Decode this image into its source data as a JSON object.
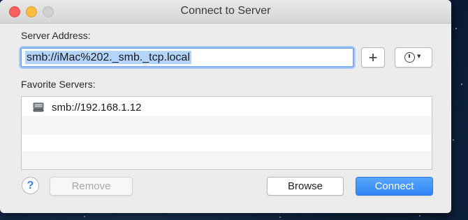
{
  "window": {
    "title": "Connect to Server"
  },
  "server_address": {
    "label": "Server Address:",
    "value": "smb://iMac%202._smb._tcp.local",
    "add_button": "+"
  },
  "favorites": {
    "label": "Favorite Servers:",
    "items": [
      {
        "address": "smb://192.168.1.12",
        "icon": "server-drive-icon"
      }
    ]
  },
  "buttons": {
    "help": "?",
    "remove": "Remove",
    "browse": "Browse",
    "connect": "Connect"
  },
  "colors": {
    "accent": "#2f86f6",
    "close": "#fc605c",
    "minimize": "#fdbc40"
  }
}
